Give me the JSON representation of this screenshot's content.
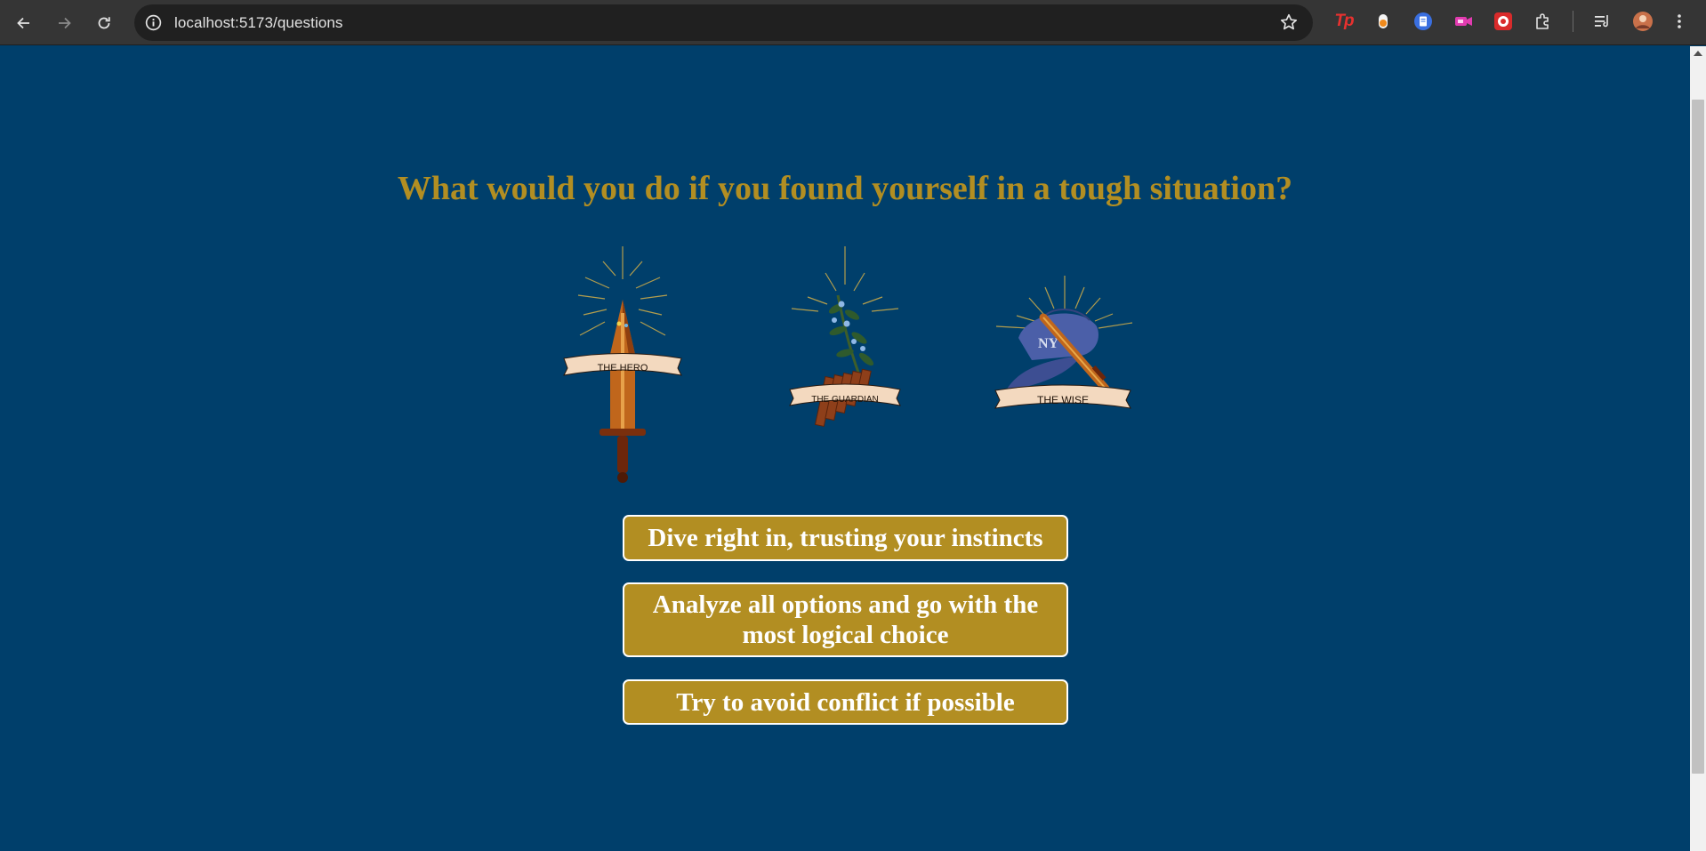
{
  "browser": {
    "url": "localhost:5173/questions"
  },
  "extensions": {
    "icons": [
      "tp-extension-icon",
      "fox-extension-icon",
      "docs-extension-icon",
      "video-extension-icon",
      "red-extension-icon",
      "puzzle-extensions-icon",
      "reading-list-icon",
      "profile-avatar",
      "menu-kebab-icon"
    ],
    "tp_label": "Tp"
  },
  "quiz": {
    "question": "What would you do if you found yourself in a tough situation?",
    "emblems": [
      {
        "icon": "sword-emblem-icon",
        "label": "THE HERO"
      },
      {
        "icon": "flute-emblem-icon",
        "label": "THE GUARDIAN"
      },
      {
        "icon": "cap-emblem-icon",
        "label": "THE WISE"
      }
    ],
    "choices": [
      "Dive right in, trusting your instincts",
      "Analyze all options and go with the most logical choice",
      "Try to avoid conflict if possible"
    ]
  },
  "colors": {
    "page_background": "#003f6b",
    "accent_gold": "#b28e22",
    "button_border": "#ffffff"
  }
}
